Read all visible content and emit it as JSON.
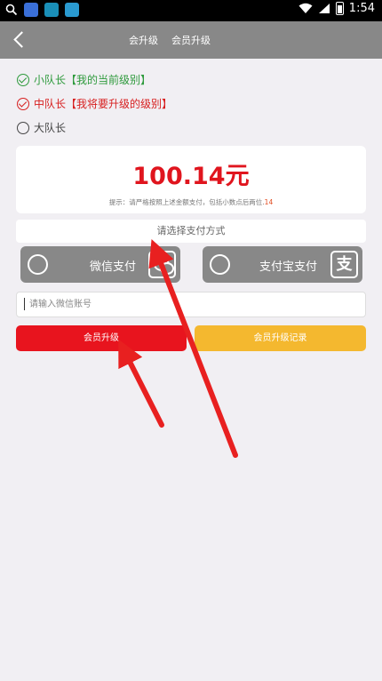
{
  "status_bar": {
    "time": "1:54",
    "icons": [
      "search-icon",
      "wifi-icon",
      "signal-icon",
      "battery-icon"
    ]
  },
  "nav": {
    "title_left": "会升级",
    "title_right": "会员升级",
    "back_icon": "chevron-left-icon"
  },
  "levels": [
    {
      "name": "小队长",
      "tag": "【我的当前级别】",
      "state": "checked",
      "color": "#2e9a3c"
    },
    {
      "name": "中队长",
      "tag": "【我将要升级的级别】",
      "state": "checked",
      "color": "#d71f1f"
    },
    {
      "name": "大队长",
      "tag": "",
      "state": "unchecked",
      "color": "#444444"
    }
  ],
  "amount": {
    "value": "100.14元",
    "hint_prefix": "提示：请严格按照上述金额支付，包括小数点后两位.",
    "hint_number": "14"
  },
  "payment": {
    "title": "请选择支付方式",
    "wechat_label": "微信支付",
    "alipay_label": "支付宝支付",
    "alipay_glyph": "支"
  },
  "wechat_input": {
    "placeholder": "请输入微信账号",
    "value": ""
  },
  "buttons": {
    "upgrade": "会员升级",
    "record": "会员升级记录"
  },
  "colors": {
    "nav_bg": "#888888",
    "amount": "#e0151e",
    "upgrade_button": "#e8141e",
    "record_button": "#f4b82f",
    "annotation_arrow": "#e82020"
  }
}
